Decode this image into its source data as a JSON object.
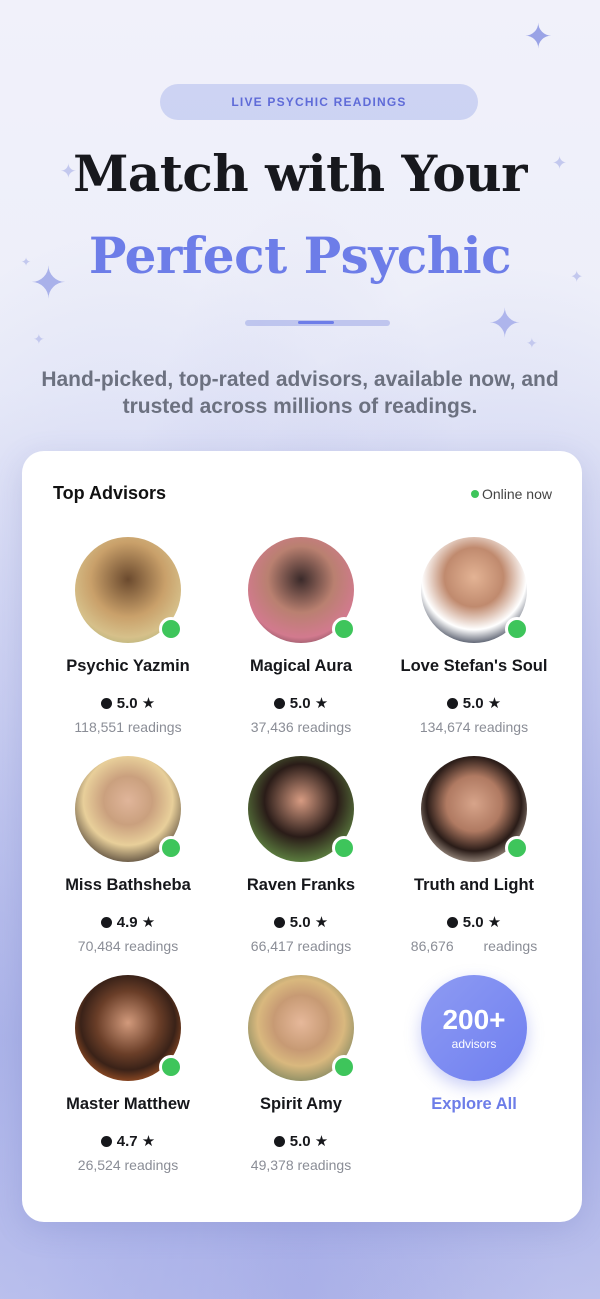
{
  "badge": "LIVE PSYCHIC READINGS",
  "headline": {
    "line1": "Match with Your",
    "line2": "Perfect Psychic"
  },
  "subtitle": "Hand-picked, top-rated advisors, available now, and trusted across millions of readings.",
  "card": {
    "title": "Top Advisors",
    "online_label": "Online now",
    "advisors": [
      {
        "name": "Psychic Yazmin",
        "rating": "5.0 ★",
        "readings": "118,551 readings"
      },
      {
        "name": "Magical Aura",
        "rating": "5.0 ★",
        "readings": "37,436 readings"
      },
      {
        "name": "Love Stefan's Soul",
        "rating": "5.0 ★",
        "readings": "134,674 readings"
      },
      {
        "name": "Miss Bathsheba",
        "rating": "4.9 ★",
        "readings": "70,484 readings"
      },
      {
        "name": "Raven Franks",
        "rating": "5.0 ★",
        "readings": "66,417 readings"
      },
      {
        "name": "Truth and Light",
        "rating": "5.0 ★",
        "readings": "86,676 readings"
      },
      {
        "name": "Master Matthew",
        "rating": "4.7 ★",
        "readings": "26,524 readings"
      },
      {
        "name": "Spirit Amy",
        "rating": "5.0 ★",
        "readings": "49,378 readings"
      }
    ],
    "more": {
      "count": "200+",
      "label": "advisors",
      "cta": "Explore All"
    }
  },
  "colors": {
    "accent": "#6d7de8",
    "online": "#3ec55b",
    "headline": "#17181d"
  }
}
